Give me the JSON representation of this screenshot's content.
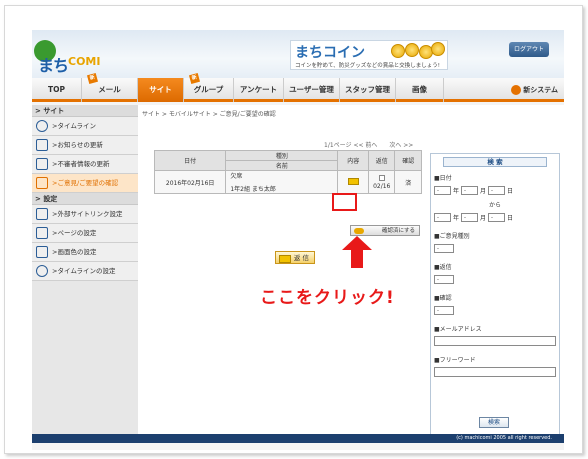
{
  "header": {
    "logo_text": "まち",
    "logo_sub": "COMI",
    "banner_title": "まちコイン",
    "banner_sub": "コインを貯めて、防災グッズなどの賞品と交換しましょう!",
    "logout_label": "ログアウト"
  },
  "nav": {
    "items": [
      {
        "label": "TOP"
      },
      {
        "label": "メール",
        "badge": "新"
      },
      {
        "label": "サイト"
      },
      {
        "label": "グループ",
        "badge": "新"
      },
      {
        "label": "アンケート"
      },
      {
        "label": "ユーザー管理"
      },
      {
        "label": "スタッフ管理"
      },
      {
        "label": "画像"
      }
    ],
    "right_label": "新システム"
  },
  "sidebar": {
    "section1": "サイト",
    "items1": [
      "タイムライン",
      "お知らせの更新",
      "不審者情報の更新",
      "ご意見/ご要望の確認"
    ],
    "section2": "設定",
    "items2": [
      "外部サイトリンク設定",
      "ページの設定",
      "画面色の設定",
      "タイムラインの設定"
    ]
  },
  "main": {
    "breadcrumb": "サイト > モバイルサイト > ご意見/ご要望の確認",
    "pager_prev": "1/1ページ << 前へ",
    "pager_next": "次へ >>",
    "table": {
      "headers": {
        "date": "日付",
        "kind": "種別",
        "name": "名前",
        "content": "内容",
        "reply": "返信",
        "confirm": "確認"
      },
      "rows": [
        {
          "date": "2016年02月16日",
          "kind": "欠席",
          "name": "1年2組 まち太郎",
          "reply": "02/16",
          "confirm": "済"
        }
      ]
    },
    "confirm_button": "確認済にする",
    "reply_button": "返 信",
    "annotation": "ここをクリック!"
  },
  "search": {
    "title": "検 索",
    "date_label": "■日付",
    "year": "年",
    "month": "月",
    "day": "日",
    "from": "から",
    "select_placeholder": "-",
    "kind_label": "■ご意見種別",
    "reply_label": "■返信",
    "confirm_label": "■確認",
    "mail_label": "■メールアドレス",
    "free_label": "■フリーワード",
    "button": "検索"
  },
  "footer": {
    "copyright": "(c) machicomi 2005 all right reserved."
  },
  "colors": {
    "accent": "#e47100",
    "highlight": "#e81919",
    "navy": "#1c3f6e"
  }
}
